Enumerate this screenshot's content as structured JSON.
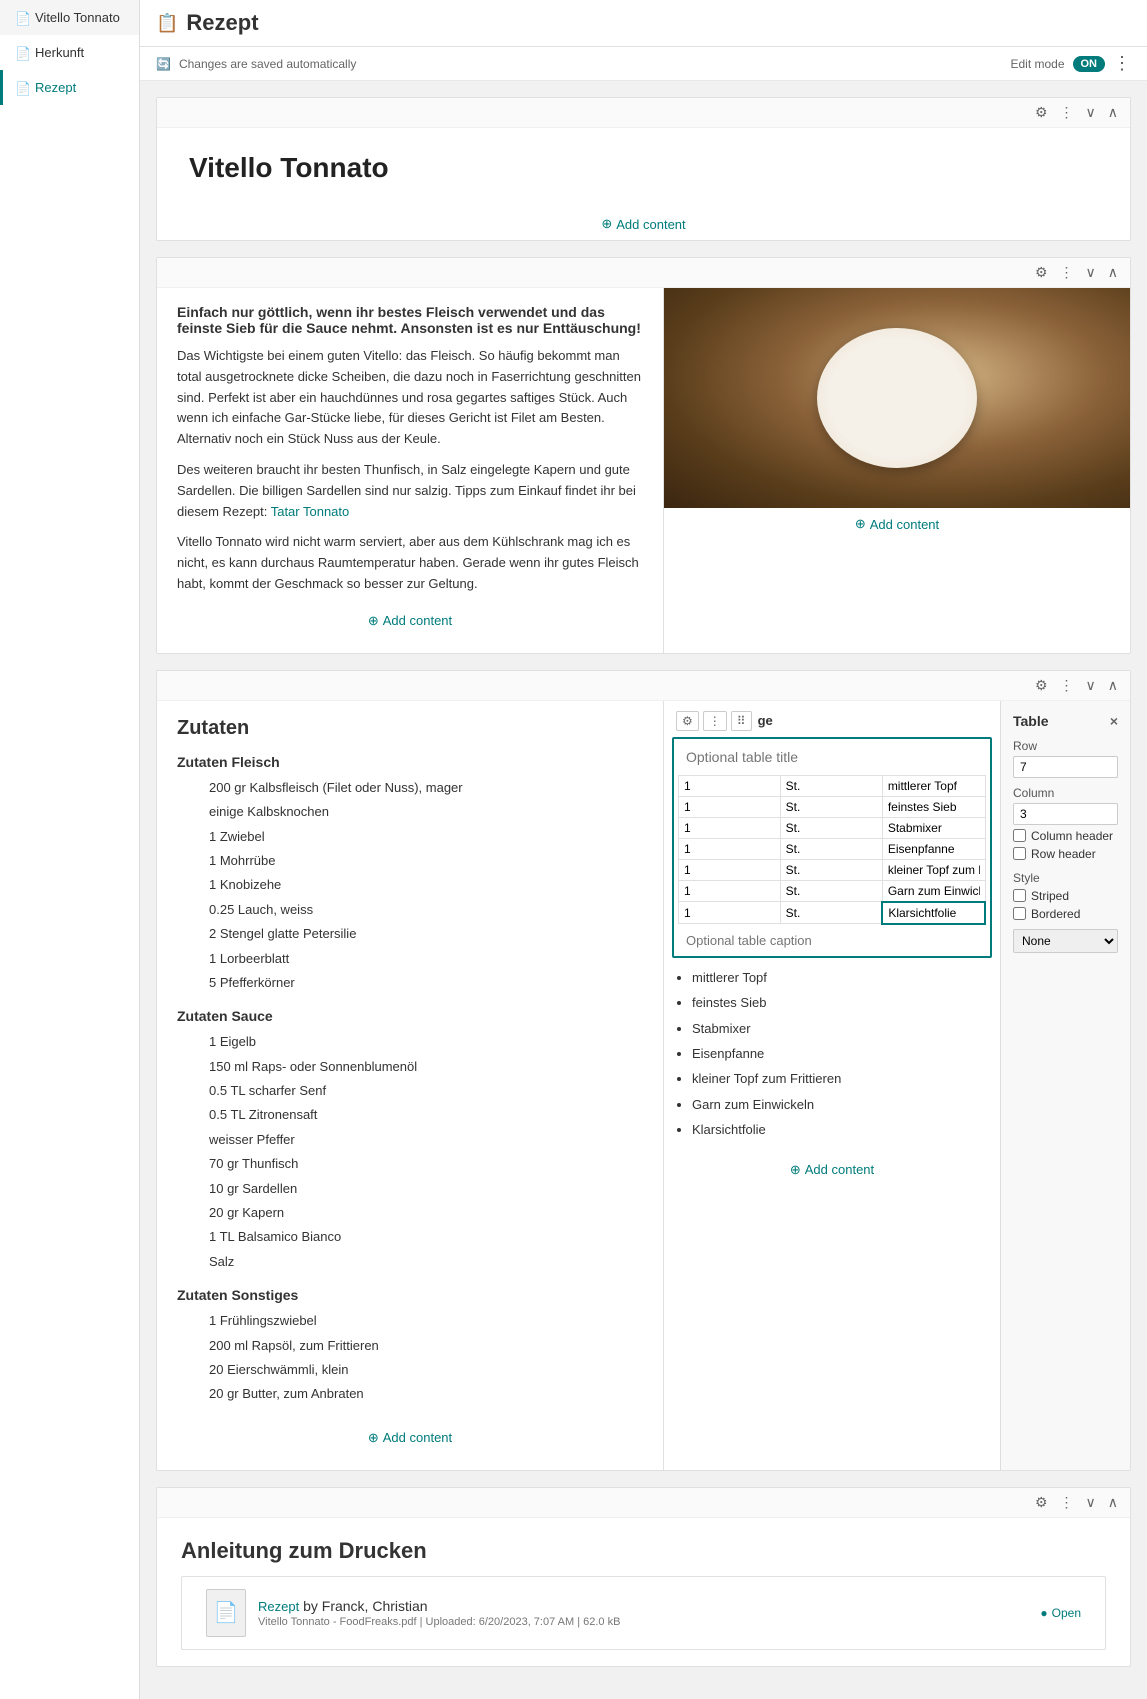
{
  "sidebar": {
    "items": [
      {
        "id": "vitello-tonnato",
        "label": "Vitello Tonnato",
        "icon": "doc-icon",
        "active": false
      },
      {
        "id": "herkunft",
        "label": "Herkunft",
        "icon": "doc-icon",
        "active": false
      },
      {
        "id": "rezept",
        "label": "Rezept",
        "icon": "doc-icon-teal",
        "active": true
      }
    ]
  },
  "topbar": {
    "page_title": "Rezept",
    "autosave_label": "Changes are saved automatically",
    "edit_mode_label": "Edit mode",
    "edit_mode_value": "ON",
    "more_icon": "⋮"
  },
  "block1": {
    "title": "Vitello Tonnato",
    "add_content_label": "Add content"
  },
  "block2": {
    "add_content_left": "Add content",
    "add_content_right": "Add content",
    "intro_bold": "Einfach nur göttlich, wenn ihr bestes Fleisch verwendet und das feinste Sieb für die Sauce nehmt. Ansonsten ist es nur Enttäuschung!",
    "paragraphs": [
      "Das Wichtigste bei einem guten Vitello: das Fleisch. So häufig bekommt man total ausgetrocknete dicke Scheiben, die dazu noch in Faserrichtung geschnitten sind. Perfekt ist aber ein hauchdünnes und rosa gegartes saftiges Stück. Auch wenn ich einfache Gar-Stücke liebe, für dieses Gericht ist Filet am Besten. Alternativ noch ein Stück Nuss aus der Keule.",
      "Des weiteren braucht ihr besten Thunfisch, in Salz eingelegte Kapern und gute Sardellen. Die billigen Sardellen sind nur salzig. Tipps zum Einkauf findet ihr bei diesem Rezept:",
      "Vitello Tonnato wird nicht warm serviert, aber aus dem Kühlschrank mag ich es nicht, es kann durchaus Raumtemperatur haben. Gerade wenn ihr gutes Fleisch habt, kommt der Geschmack so besser zur Geltung."
    ],
    "link_text": "Tatar Tonnato"
  },
  "block3": {
    "ingredients": {
      "title": "Zutaten",
      "sections": [
        {
          "title": "Zutaten Fleisch",
          "items": [
            "200 gr Kalbsfleisch (Filet oder Nuss), mager",
            "einige Kalbsknochen",
            "1 Zwiebel",
            "1 Mohrrübe",
            "1 Knobizehe",
            "0.25 Lauch, weiss",
            "2 Stengel glatte Petersilie",
            "1 Lorbeerblatt",
            "5 Pfefferkörner"
          ]
        },
        {
          "title": "Zutaten Sauce",
          "items": [
            "1 Eigelb",
            "150 ml Raps- oder Sonnenblumenöl",
            "0.5 TL scharfer Senf",
            "0.5 TL Zitronensaft",
            "weisser Pfeffer",
            "70 gr Thunfisch",
            "10 gr Sardellen",
            "20 gr Kapern",
            "1 TL Balsamico Bianco",
            "Salz"
          ]
        },
        {
          "title": "Zutaten Sonstiges",
          "items": [
            "1 Frühlingszwiebel",
            "200 ml Rapsöl, zum Frittieren",
            "20 Eierschwämmli, klein",
            "20 gr Butter, zum Anbraten"
          ]
        }
      ]
    },
    "table": {
      "title_placeholder": "Optional table title",
      "caption_placeholder": "Optional table caption",
      "rows": [
        [
          "1",
          "St.",
          "mittlerer Topf"
        ],
        [
          "1",
          "St.",
          "feinstes Sieb"
        ],
        [
          "1",
          "St.",
          "Stabmixer"
        ],
        [
          "1",
          "St.",
          "Eisenpfanne"
        ],
        [
          "1",
          "St.",
          "kleiner Topf zum Fr"
        ],
        [
          "1",
          "St.",
          "Garn zum Einwickel"
        ],
        [
          "1",
          "St.",
          "Klarsichtfolie"
        ]
      ],
      "bullet_list": [
        "mittlerer Topf",
        "feinstes Sieb",
        "Stabmixer",
        "Eisenpfanne",
        "kleiner Topf zum Frittieren",
        "Garn zum Einwickeln",
        "Klarsichtfolie"
      ]
    },
    "add_content_left": "Add content",
    "add_content_right": "Add content"
  },
  "right_panel": {
    "title": "Table",
    "close_icon": "×",
    "row_label": "Row",
    "row_value": "7",
    "column_label": "Column",
    "column_value": "3",
    "column_header_label": "Column header",
    "row_header_label": "Row header",
    "style_label": "Style",
    "striped_label": "Striped",
    "bordered_label": "Bordered",
    "dropdown_options": [
      "None"
    ],
    "dropdown_value": "None"
  },
  "block4": {
    "title": "Anleitung zum Drucken",
    "file": {
      "name": "Rezept",
      "author": "by Franck, Christian",
      "meta": "Vitello Tonnato - FoodFreaks.pdf | Uploaded: 6/20/2023, 7:07 AM | 62.0 kB",
      "open_label": "Open"
    }
  },
  "toolbar_icons": {
    "gear": "⚙",
    "dots": "⋮",
    "chevron_down": "∨",
    "chevron_up": "∧",
    "drag": "⠿",
    "plus": "+"
  }
}
